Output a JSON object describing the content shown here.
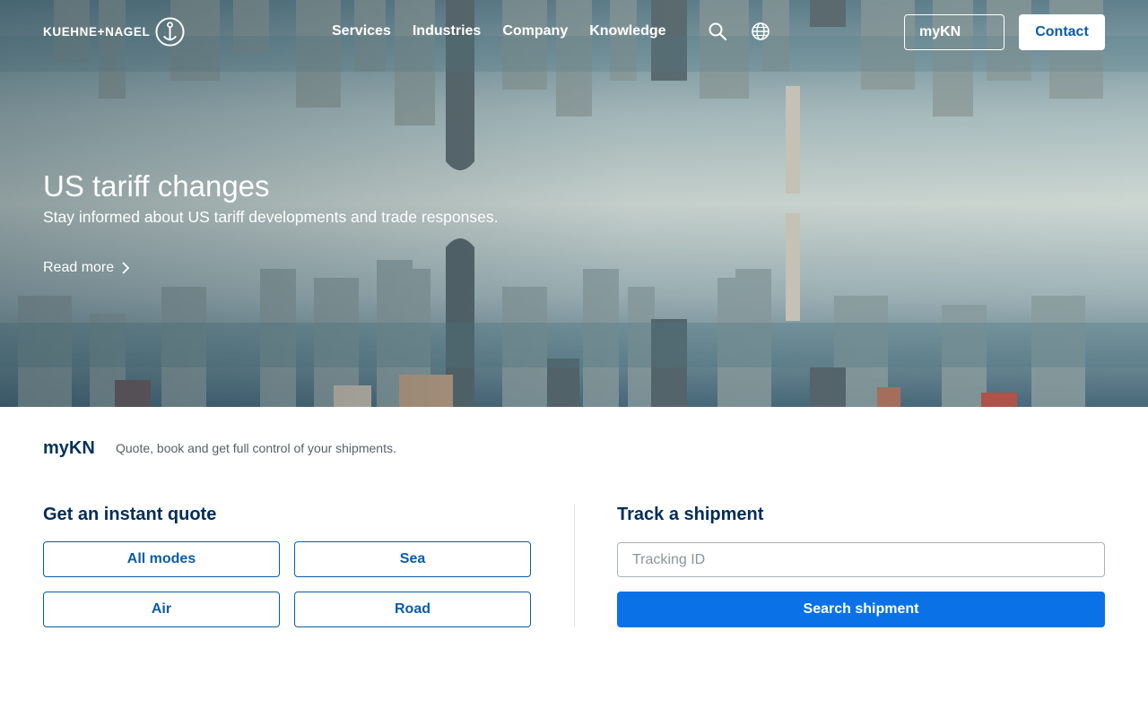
{
  "header": {
    "logo_text": "KUEHNE+NAGEL",
    "nav": [
      "Services",
      "Industries",
      "Company",
      "Knowledge"
    ],
    "search_icon": "search-icon",
    "globe_icon": "globe-icon",
    "mykn_label": "myKN",
    "contact_label": "Contact"
  },
  "hero": {
    "title": "US tariff changes",
    "subtitle": "Stay informed about US tariff developments and trade responses.",
    "read_more": "Read more"
  },
  "mykn": {
    "label": "myKN",
    "tagline": "Quote, book and get full control of your shipments."
  },
  "quote": {
    "title": "Get an instant quote",
    "modes": [
      "All modes",
      "Sea",
      "Air",
      "Road"
    ]
  },
  "track": {
    "title": "Track a shipment",
    "placeholder": "Tracking ID",
    "button": "Search shipment"
  },
  "colors": {
    "brand_blue": "#0a5ca8",
    "primary_button": "#0a72e6",
    "heading_navy": "#002c5a"
  }
}
